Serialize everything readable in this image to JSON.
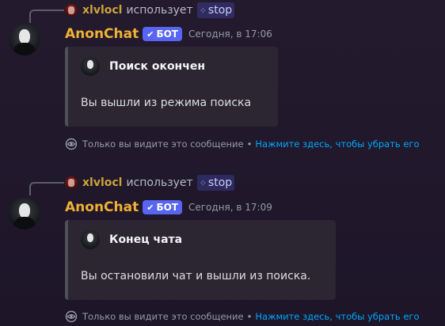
{
  "messages": [
    {
      "reference": {
        "user": "xlvlocl",
        "action": "использует",
        "command": "stop"
      },
      "author": "AnonChat",
      "bot_tag": "БОТ",
      "timestamp": "Сегодня, в 17:06",
      "embed": {
        "title": "Поиск окончен",
        "description": "Вы вышли из режима поиска"
      },
      "footer": {
        "ephemeral_text": "Только вы видите это сообщение",
        "separator": "•",
        "dismiss_link": "Нажмите здесь, чтобы убрать его"
      }
    },
    {
      "reference": {
        "user": "xlvlocl",
        "action": "использует",
        "command": "stop"
      },
      "author": "AnonChat",
      "bot_tag": "БОТ",
      "timestamp": "Сегодня, в 17:09",
      "embed": {
        "title": "Конец чата",
        "description": "Вы остановили чат и вышли из поиска."
      },
      "footer": {
        "ephemeral_text": "Только вы видите это сообщение",
        "separator": "•",
        "dismiss_link": "Нажмите здесь, чтобы убрать его"
      }
    }
  ],
  "colors": {
    "author": "#f0b232",
    "bot_tag": "#5865f2",
    "reference_user": "#c9a33a",
    "link": "#00a8fc",
    "embed_bg": "#2b2632"
  }
}
